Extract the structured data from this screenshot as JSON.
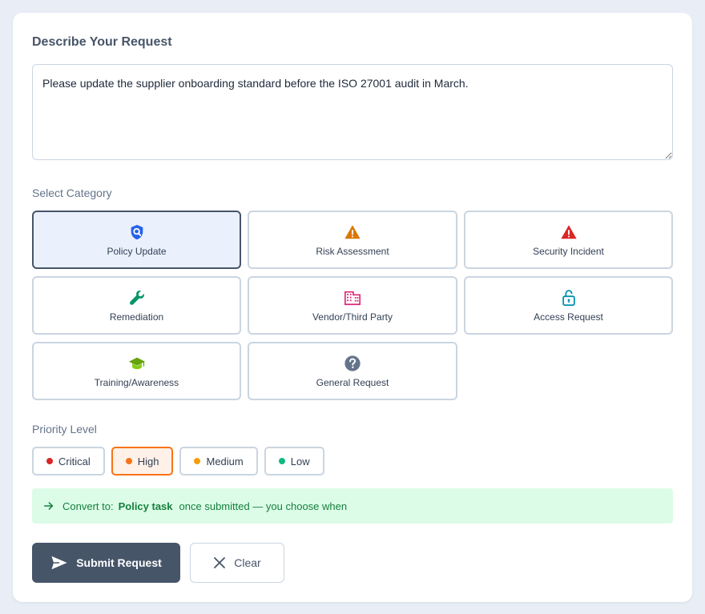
{
  "form": {
    "title": "Describe Your Request",
    "request_text": "Please update the supplier onboarding standard before the ISO 27001 audit in March."
  },
  "category": {
    "label": "Select Category",
    "items": [
      {
        "label": "Policy Update",
        "icon": "shield-search-icon",
        "color": "#2563eb",
        "selected": true
      },
      {
        "label": "Risk Assessment",
        "icon": "warning-triangle-icon",
        "color": "#d97706",
        "selected": false
      },
      {
        "label": "Security Incident",
        "icon": "alert-triangle-icon",
        "color": "#dc2626",
        "selected": false
      },
      {
        "label": "Remediation",
        "icon": "wrench-icon",
        "color": "#059669",
        "selected": false
      },
      {
        "label": "Vendor/Third Party",
        "icon": "building-icon",
        "color": "#db2777",
        "selected": false
      },
      {
        "label": "Access Request",
        "icon": "unlock-icon",
        "color": "#0891b2",
        "selected": false
      },
      {
        "label": "Training/Awareness",
        "icon": "graduation-cap-icon",
        "color": "#65a30d",
        "selected": false
      },
      {
        "label": "General Request",
        "icon": "question-circle-icon",
        "color": "#64748b",
        "selected": false
      }
    ]
  },
  "priority": {
    "label": "Priority Level",
    "items": [
      {
        "label": "Critical",
        "color": "#dc2626",
        "selected": false
      },
      {
        "label": "High",
        "color": "#f97316",
        "selected": true
      },
      {
        "label": "Medium",
        "color": "#f59e0b",
        "selected": false
      },
      {
        "label": "Low",
        "color": "#10b981",
        "selected": false
      }
    ]
  },
  "notice": {
    "prefix": "Convert to:",
    "target": "Policy task",
    "suffix": "once submitted — you choose when",
    "icon": "arrow-right-icon"
  },
  "actions": {
    "submit_label": "Submit Request",
    "submit_icon": "send-icon",
    "clear_label": "Clear",
    "clear_icon": "close-icon"
  },
  "colors": {
    "accent": "#475569",
    "selected_bg": "#eaf1fd",
    "priority_selected_border": "#f97316",
    "notice_bg": "#dcfce7",
    "notice_text": "#15803d"
  }
}
